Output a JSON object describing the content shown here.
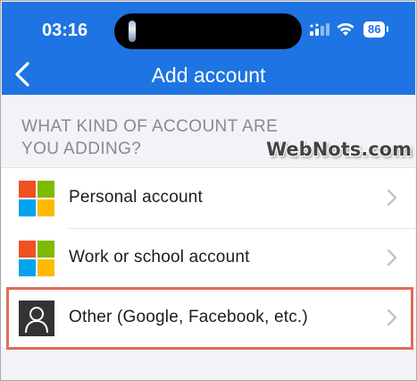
{
  "status_bar": {
    "time": "03:16",
    "battery": "86",
    "icons": [
      "signal-icon",
      "wifi-icon",
      "battery-icon"
    ]
  },
  "header": {
    "title": "Add account",
    "back_icon": "chevron-left-icon",
    "background_color": "#1e74e2"
  },
  "section": {
    "title": "WHAT KIND OF ACCOUNT ARE YOU ADDING?"
  },
  "watermark": "WebNots.com",
  "accounts": [
    {
      "label": "Personal account",
      "icon": "microsoft-logo-icon"
    },
    {
      "label": "Work or school account",
      "icon": "microsoft-logo-icon"
    },
    {
      "label": "Other (Google, Facebook, etc.)",
      "icon": "user-icon"
    }
  ],
  "highlight_color": "#e06b5b"
}
